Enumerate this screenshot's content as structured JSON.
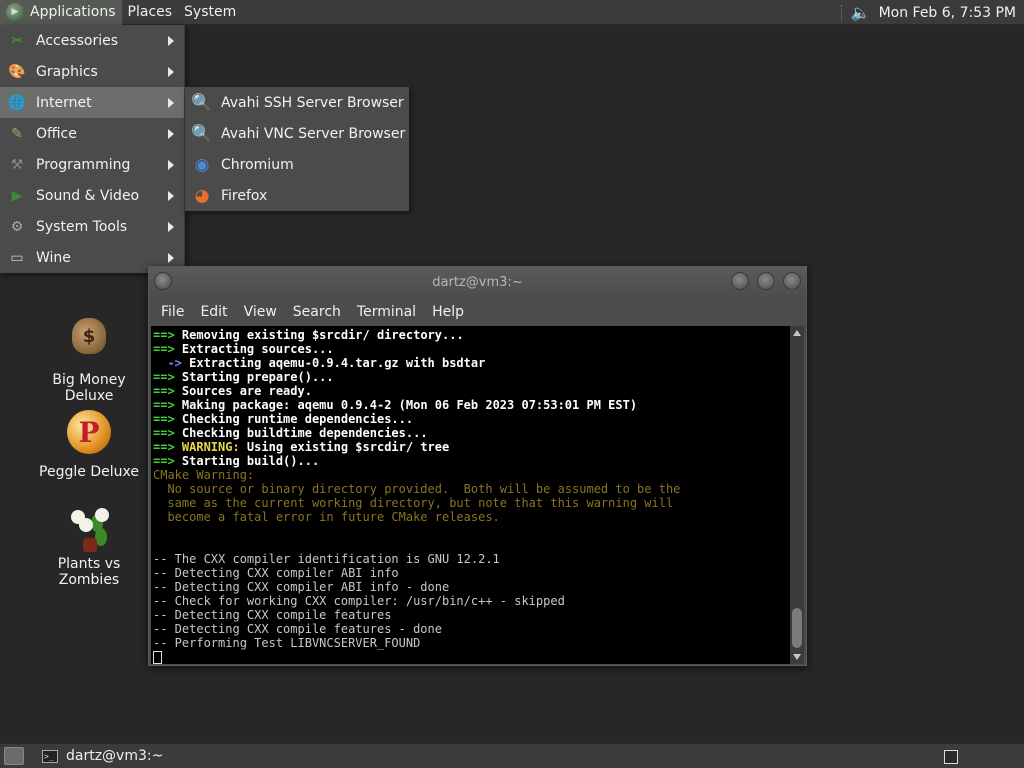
{
  "top_panel": {
    "applications": "Applications",
    "places": "Places",
    "system": "System",
    "clock": "Mon Feb  6,  7:53 PM"
  },
  "applications_menu": [
    {
      "label": "Accessories",
      "icon": "accessories-icon",
      "color": "#4a9a3a"
    },
    {
      "label": "Graphics",
      "icon": "graphics-icon",
      "color": "#c07a30"
    },
    {
      "label": "Internet",
      "icon": "internet-icon",
      "color": "#3a6ab0"
    },
    {
      "label": "Office",
      "icon": "office-icon",
      "color": "#b0a070"
    },
    {
      "label": "Programming",
      "icon": "programming-icon",
      "color": "#888888"
    },
    {
      "label": "Sound & Video",
      "icon": "sound-video-icon",
      "color": "#3a8a3a"
    },
    {
      "label": "System Tools",
      "icon": "system-tools-icon",
      "color": "#aaaaaa"
    },
    {
      "label": "Wine",
      "icon": "wine-icon",
      "color": "#cccccc"
    }
  ],
  "internet_submenu": [
    {
      "label": "Avahi SSH Server Browser",
      "icon": "avahi-ssh-icon"
    },
    {
      "label": "Avahi VNC Server Browser",
      "icon": "avahi-vnc-icon"
    },
    {
      "label": "Chromium",
      "icon": "chromium-icon"
    },
    {
      "label": "Firefox",
      "icon": "firefox-icon"
    }
  ],
  "desktop_icons": [
    {
      "label": "Big Money Deluxe",
      "icon": "big-money-icon"
    },
    {
      "label": "Peggle Deluxe",
      "icon": "peggle-icon"
    },
    {
      "label": "Plants vs Zombies",
      "icon": "plants-vs-zombies-icon"
    }
  ],
  "terminal": {
    "title": "dartz@vm3:~",
    "menu": [
      "File",
      "Edit",
      "View",
      "Search",
      "Terminal",
      "Help"
    ],
    "lines": [
      {
        "prefix": "==> ",
        "text": "Removing existing $srcdir/ directory...",
        "style": "w"
      },
      {
        "prefix": "==> ",
        "text": "Extracting sources...",
        "style": "w"
      },
      {
        "prefix": "  -> ",
        "text": "Extracting aqemu-0.9.4.tar.gz with bsdtar",
        "style": "w",
        "prefix_style": "b"
      },
      {
        "prefix": "==> ",
        "text": "Starting prepare()...",
        "style": "w"
      },
      {
        "prefix": "==> ",
        "text": "Sources are ready.",
        "style": "w"
      },
      {
        "prefix": "==> ",
        "text": "Making package: aqemu 0.9.4-2 (Mon 06 Feb 2023 07:53:01 PM EST)",
        "style": "w"
      },
      {
        "prefix": "==> ",
        "text": "Checking runtime dependencies...",
        "style": "w"
      },
      {
        "prefix": "==> ",
        "text": "Checking buildtime dependencies...",
        "style": "w"
      },
      {
        "prefix": "==> ",
        "warn": "WARNING:",
        "text": " Using existing $srcdir/ tree",
        "style": "w"
      },
      {
        "prefix": "==> ",
        "text": "Starting build()...",
        "style": "w"
      },
      {
        "prefix": "",
        "text": "CMake Warning:",
        "style": "dim"
      },
      {
        "prefix": "",
        "text": "  No source or binary directory provided.  Both will be assumed to be the",
        "style": "dim"
      },
      {
        "prefix": "",
        "text": "  same as the current working directory, but note that this warning will",
        "style": "dim"
      },
      {
        "prefix": "",
        "text": "  become a fatal error in future CMake releases.",
        "style": "dim"
      },
      {
        "prefix": "",
        "text": "",
        "style": "n"
      },
      {
        "prefix": "",
        "text": "",
        "style": "n"
      },
      {
        "prefix": "",
        "text": "-- The CXX compiler identification is GNU 12.2.1",
        "style": "n"
      },
      {
        "prefix": "",
        "text": "-- Detecting CXX compiler ABI info",
        "style": "n"
      },
      {
        "prefix": "",
        "text": "-- Detecting CXX compiler ABI info - done",
        "style": "n"
      },
      {
        "prefix": "",
        "text": "-- Check for working CXX compiler: /usr/bin/c++ - skipped",
        "style": "n"
      },
      {
        "prefix": "",
        "text": "-- Detecting CXX compile features",
        "style": "n"
      },
      {
        "prefix": "",
        "text": "-- Detecting CXX compile features - done",
        "style": "n"
      },
      {
        "prefix": "",
        "text": "-- Performing Test LIBVNCSERVER_FOUND",
        "style": "n"
      }
    ]
  },
  "taskbar": {
    "task_label": "dartz@vm3:~"
  }
}
